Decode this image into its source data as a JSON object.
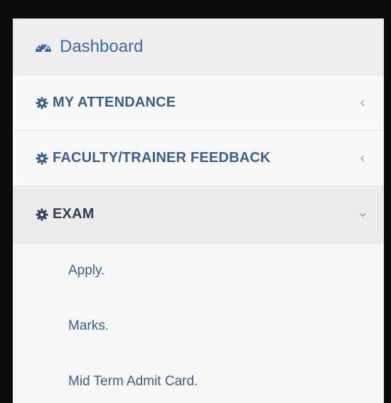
{
  "sidebar": {
    "dashboard": {
      "label": "Dashboard",
      "icon": "dashboard-gauge-icon"
    },
    "sections": [
      {
        "label": "MY ATTENDANCE",
        "icon": "gear-icon",
        "chevron": "chevron-left-icon"
      },
      {
        "label": "FACULTY/TRAINER FEEDBACK",
        "icon": "gear-icon",
        "chevron": "chevron-left-icon"
      },
      {
        "label": "EXAM",
        "icon": "gear-icon",
        "chevron": "chevron-down-icon"
      }
    ],
    "exam_submenu": [
      {
        "label": "Apply."
      },
      {
        "label": "Marks."
      },
      {
        "label": "Mid Term Admit Card."
      }
    ]
  },
  "colors": {
    "link_blue": "#3b5f8c",
    "sidebar_bg": "#f7f7f7",
    "active_bg": "#ececec",
    "frame": "#0b0b0b",
    "background_orange": "#b8641a"
  }
}
